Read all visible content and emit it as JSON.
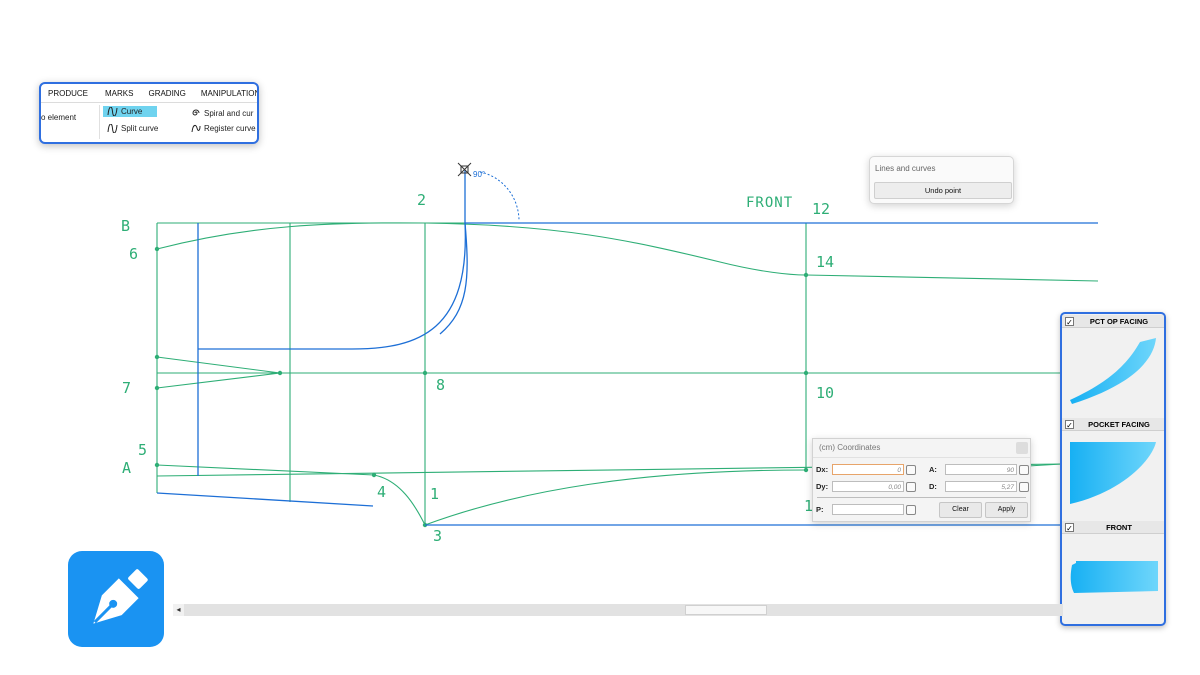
{
  "ribbon": {
    "tabs": [
      "PRODUCE",
      "MARKS",
      "GRADING",
      "MANIPULATION"
    ],
    "items": {
      "element": "o element",
      "curve": "Curve",
      "split_curve": "Split curve",
      "spiral": "Spiral and cur",
      "register": "Register curve"
    }
  },
  "drawing": {
    "front_label": "FRONT",
    "angle_label": "90°",
    "point_labels": {
      "b": "B",
      "a": "A",
      "p1": "1",
      "p2": "2",
      "p3": "3",
      "p4": "4",
      "p5": "5",
      "p6": "6",
      "p7": "7",
      "p8": "8",
      "p10": "10",
      "p12": "12",
      "p14": "14",
      "p1b": "1"
    },
    "colors": {
      "pattern": "#2eae76",
      "curve": "#1d6fd6"
    }
  },
  "popup": {
    "title": "Lines and curves",
    "undo_button": "Undo point"
  },
  "coordinates": {
    "title": "(cm) Coordinates",
    "dx_label": "Dx:",
    "dx_value": "0",
    "dy_label": "Dy:",
    "dy_value": "0,00",
    "a_label": "A:",
    "a_value": "90",
    "d_label": "D:",
    "d_value": "5,27",
    "p_label": "P:",
    "p_value": "",
    "clear_button": "Clear",
    "apply_button": "Apply"
  },
  "pieces": [
    {
      "name": "PCT OP FACING",
      "checked": "✓"
    },
    {
      "name": "POCKET FACING",
      "checked": "✓"
    },
    {
      "name": "FRONT",
      "checked": "✓"
    }
  ],
  "icons": {
    "app_logo": "fountain-pen-icon",
    "lock": "lock-icon",
    "curve": "curve-icon",
    "spiral": "spiral-icon"
  }
}
